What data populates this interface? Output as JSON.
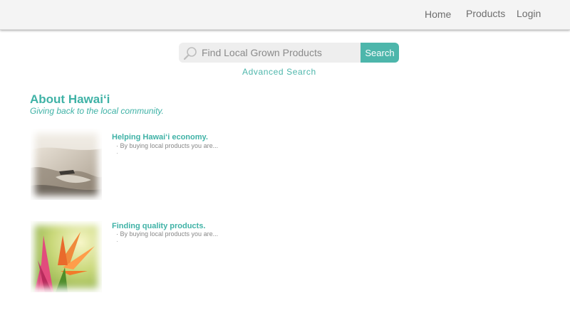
{
  "nav": {
    "items": [
      {
        "label": "Home"
      },
      {
        "label": "Products"
      },
      {
        "label": "Login"
      }
    ]
  },
  "search": {
    "placeholder": "Find Local Grown Products",
    "button_label": "Search",
    "advanced_link": "Advanced Search",
    "icon": "search-icon"
  },
  "about": {
    "title": "About Hawai‘i",
    "subtitle": "Giving back to the local community."
  },
  "items": [
    {
      "title": "Helping Hawai‘i economy.",
      "text": "· By buying local products you are...",
      "bullet": "·",
      "image": "beach-image"
    },
    {
      "title": "Finding quality products.",
      "text": "· By buying local products you are...",
      "bullet": "·",
      "image": "flower-image"
    }
  ],
  "colors": {
    "accent": "#4db6ab",
    "topbar": "#f4f4f4",
    "nav_text": "#6e6e6e",
    "body_text": "#888888"
  }
}
